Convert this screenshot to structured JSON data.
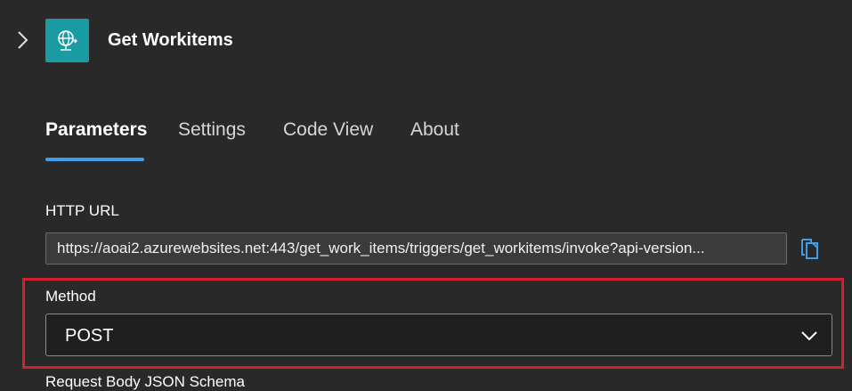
{
  "header": {
    "title": "Get Workitems",
    "icon": "globe-network-icon",
    "accent_color": "#1a9ba1"
  },
  "tabs": [
    {
      "label": "Parameters",
      "active": true
    },
    {
      "label": "Settings",
      "active": false
    },
    {
      "label": "Code View",
      "active": false
    },
    {
      "label": "About",
      "active": false
    }
  ],
  "http_url": {
    "label": "HTTP URL",
    "value": "https://aoai2.azurewebsites.net:443/get_work_items/triggers/get_workitems/invoke?api-version..."
  },
  "method": {
    "label": "Method",
    "value": "POST"
  },
  "request_body": {
    "label": "Request Body JSON Schema"
  },
  "colors": {
    "tab_underline": "#3f9ee8",
    "highlight_border": "#d4202e",
    "background": "#292929"
  }
}
